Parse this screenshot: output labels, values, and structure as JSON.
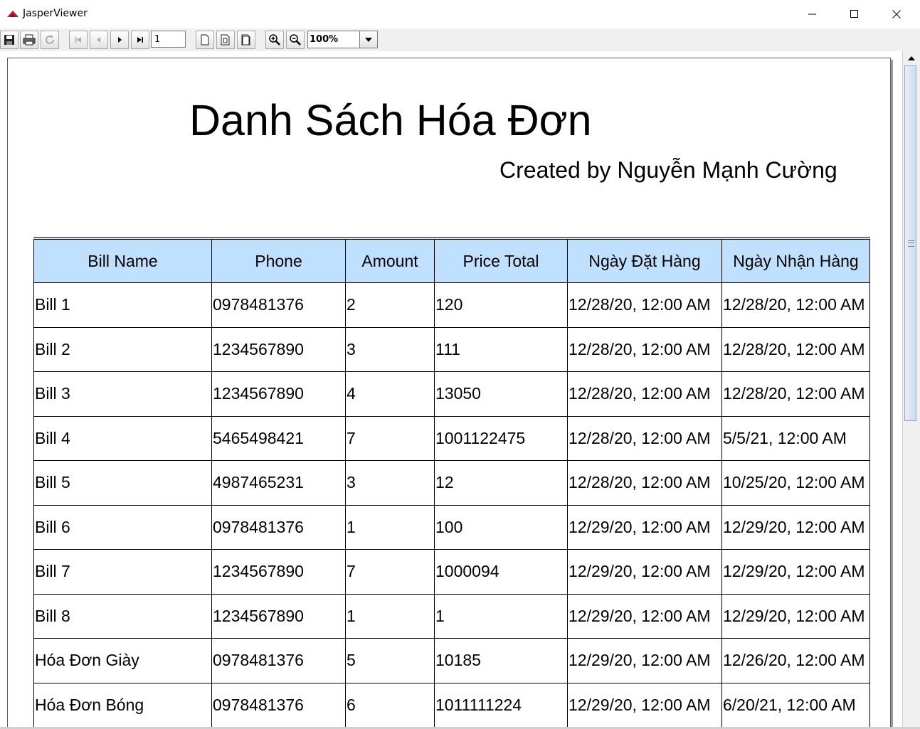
{
  "window": {
    "title": "JasperViewer"
  },
  "toolbar": {
    "page_number": "1",
    "zoom": "100%"
  },
  "report": {
    "title": "Danh Sách Hóa Đơn",
    "subtitle": "Created by Nguyễn Mạnh Cường",
    "header_color": "#bfe0ff",
    "columns": [
      "Bill Name",
      "Phone",
      "Amount",
      "Price Total",
      "Ngày Đặt Hàng",
      "Ngày Nhận Hàng"
    ],
    "rows": [
      [
        "Bill 1",
        "0978481376",
        "2",
        "120",
        "12/28/20, 12:00 AM",
        "12/28/20, 12:00 AM"
      ],
      [
        "Bill 2",
        "1234567890",
        "3",
        "111",
        "12/28/20, 12:00 AM",
        "12/28/20, 12:00 AM"
      ],
      [
        "Bill 3",
        "1234567890",
        "4",
        "13050",
        "12/28/20, 12:00 AM",
        "12/28/20, 12:00 AM"
      ],
      [
        "Bill 4",
        "5465498421",
        "7",
        "1001122475",
        "12/28/20, 12:00 AM",
        "5/5/21, 12:00 AM"
      ],
      [
        "Bill 5",
        "4987465231",
        "3",
        "12",
        "12/28/20, 12:00 AM",
        "10/25/20, 12:00 AM"
      ],
      [
        "Bill 6",
        "0978481376",
        "1",
        "100",
        "12/29/20, 12:00 AM",
        "12/29/20, 12:00 AM"
      ],
      [
        "Bill 7",
        "1234567890",
        "7",
        "1000094",
        "12/29/20, 12:00 AM",
        "12/29/20, 12:00 AM"
      ],
      [
        "Bill 8",
        "1234567890",
        "1",
        "1",
        "12/29/20, 12:00 AM",
        "12/29/20, 12:00 AM"
      ],
      [
        "Hóa Đơn Giày",
        "0978481376",
        "5",
        "10185",
        "12/29/20, 12:00 AM",
        "12/26/20, 12:00 AM"
      ],
      [
        "Hóa Đơn Bóng",
        "0978481376",
        "6",
        "1011111224",
        "12/29/20, 12:00 AM",
        "6/20/21, 12:00 AM"
      ]
    ]
  }
}
